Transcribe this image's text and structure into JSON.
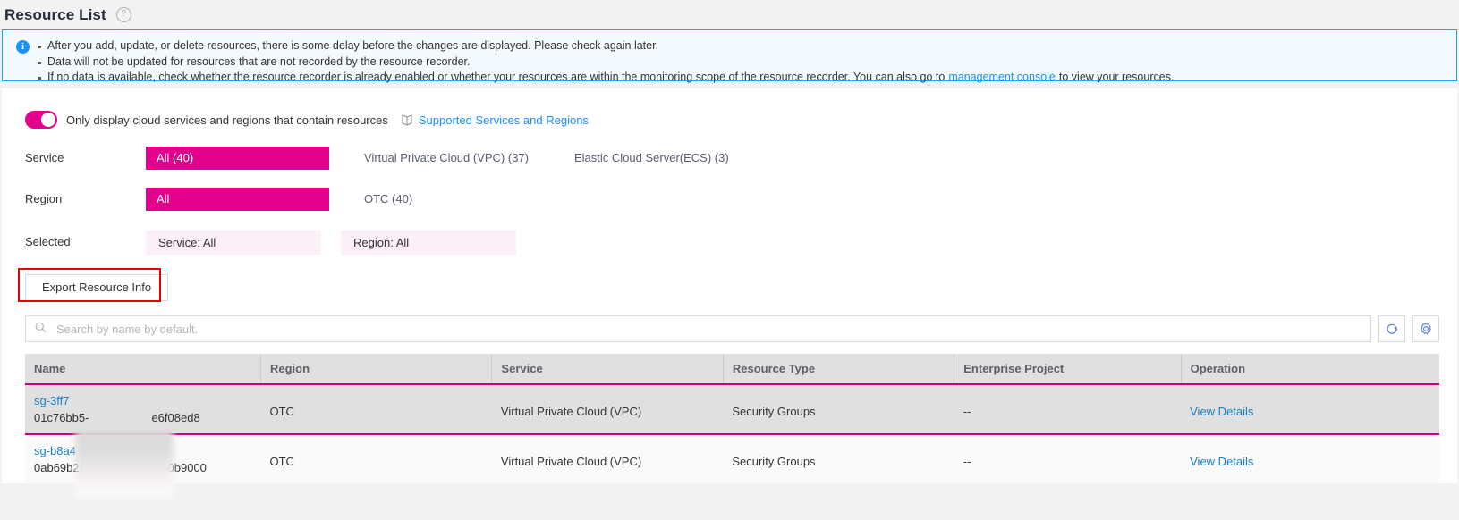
{
  "header": {
    "title": "Resource List",
    "help_icon": "question-circle-icon"
  },
  "notice": {
    "icon": "info-icon",
    "lines": [
      "After you add, update, or delete resources, there is some delay before the changes are displayed. Please check again later.",
      "Data will not be updated for resources that are not recorded by the resource recorder.",
      "If no data is available, check whether the resource recorder is already enabled or whether your resources are within the monitoring scope of the resource recorder. You can also go to"
    ],
    "link_text": "management console",
    "line3_suffix": "to view your resources."
  },
  "filters": {
    "toggle_label": "Only display cloud services and regions that contain resources",
    "toggle_on": true,
    "supported_link": "Supported Services and Regions",
    "service": {
      "label": "Service",
      "options": [
        "All (40)",
        "Virtual Private Cloud (VPC) (37)",
        "Elastic Cloud Server(ECS) (3)"
      ],
      "selected_index": 0
    },
    "region": {
      "label": "Region",
      "options": [
        "All",
        "OTC (40)"
      ],
      "selected_index": 0
    },
    "selected": {
      "label": "Selected",
      "chips": [
        "Service: All",
        "Region: All"
      ]
    }
  },
  "toolbar": {
    "export_label": "Export Resource Info",
    "highlight_color": "#e60000"
  },
  "search": {
    "placeholder": "Search by name by default.",
    "value": "",
    "search_icon": "search-icon",
    "refresh_icon": "refresh-icon",
    "settings_icon": "gear-icon"
  },
  "table": {
    "columns": [
      "Name",
      "Region",
      "Service",
      "Resource Type",
      "Enterprise Project",
      "Operation"
    ],
    "rows": [
      {
        "name": "sg-3ff7",
        "id_prefix": "01c76bb5-",
        "id_suffix": "e6f08ed8",
        "region": "OTC",
        "service": "Virtual Private Cloud (VPC)",
        "resource_type": "Security Groups",
        "enterprise_project": "--",
        "operation": "View Details",
        "highlighted": true
      },
      {
        "name": "sg-b8a4",
        "id_prefix": "0ab69b26",
        "id_suffix": "b860b9000",
        "region": "OTC",
        "service": "Virtual Private Cloud (VPC)",
        "resource_type": "Security Groups",
        "enterprise_project": "--",
        "operation": "View Details",
        "highlighted": false
      }
    ]
  },
  "colors": {
    "accent": "#e3008c",
    "link": "#1890ff",
    "info_border": "#1ca4f0",
    "highlight_border": "#c7017f"
  }
}
